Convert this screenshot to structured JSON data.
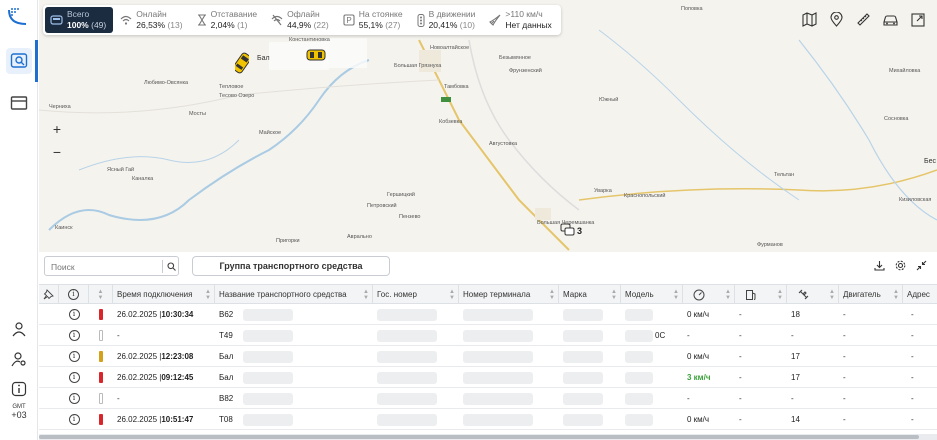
{
  "stats": [
    {
      "label": "Всего",
      "value": "100%",
      "count": "(49)",
      "icon": "car-group-icon",
      "active": true
    },
    {
      "label": "Онлайн",
      "value": "26,53%",
      "count": "(13)",
      "icon": "wifi-icon"
    },
    {
      "label": "Отставание",
      "value": "2,04%",
      "count": "(1)",
      "icon": "hourglass-icon"
    },
    {
      "label": "Офлайн",
      "value": "44,9%",
      "count": "(22)",
      "icon": "wifi-off-icon"
    },
    {
      "label": "На стоянке",
      "value": "55,1%",
      "count": "(27)",
      "icon": "parking-icon"
    },
    {
      "label": "В движении",
      "value": "20,41%",
      "count": "(10)",
      "icon": "traffic-light-icon"
    },
    {
      "label": ">110 км/ч",
      "value": "Нет данных",
      "count": "",
      "icon": "rocket-icon"
    }
  ],
  "map": {
    "zoom_in": "+",
    "zoom_out": "−",
    "cluster_count": "3",
    "places": [
      {
        "name": "Поповка",
        "cls": "p1"
      },
      {
        "name": "Новоалтайское",
        "cls": "p2"
      },
      {
        "name": "Константиновка",
        "cls": "p3"
      },
      {
        "name": "Большая Грязнуха",
        "cls": "p4"
      },
      {
        "name": "Фрунзенский",
        "cls": "p5"
      },
      {
        "name": "Безымянное",
        "cls": "p6"
      },
      {
        "name": "Михайловка",
        "cls": "p7"
      },
      {
        "name": "Тамбовка",
        "cls": "p8"
      },
      {
        "name": "Любимо-Овсянка",
        "cls": "p9"
      },
      {
        "name": "Тепловое",
        "cls": "p10"
      },
      {
        "name": "Тесово Озеро",
        "cls": "p11"
      },
      {
        "name": "Мосты",
        "cls": "p12"
      },
      {
        "name": "Черниха",
        "cls": "p13"
      },
      {
        "name": "Кобзевка",
        "cls": "p14"
      },
      {
        "name": "Южный",
        "cls": "p15"
      },
      {
        "name": "Майское",
        "cls": "p16"
      },
      {
        "name": "Августовка",
        "cls": "p17"
      },
      {
        "name": "Ясный Гай",
        "cls": "p18"
      },
      {
        "name": "Каналка",
        "cls": "p19"
      },
      {
        "name": "Уварка",
        "cls": "p20"
      },
      {
        "name": "Краснопольский",
        "cls": "p21"
      },
      {
        "name": "Тельтан",
        "cls": "p22"
      },
      {
        "name": "Гершицкий",
        "cls": "p23"
      },
      {
        "name": "Петровский",
        "cls": "p24"
      },
      {
        "name": "Пензево",
        "cls": "p25"
      },
      {
        "name": "Кизиловская",
        "cls": "p26"
      },
      {
        "name": "Аврально",
        "cls": "p27"
      },
      {
        "name": "Пригорки",
        "cls": "p28"
      },
      {
        "name": "Большая Черемшанка",
        "cls": "p29"
      },
      {
        "name": "Фурманов",
        "cls": "p30"
      },
      {
        "name": "Каинск",
        "cls": "p31"
      },
      {
        "name": "Сосновка",
        "cls": "p32"
      },
      {
        "name": "Бал",
        "cls": "p33"
      },
      {
        "name": "Бес",
        "cls": "p34"
      }
    ]
  },
  "toolbar": {
    "search_placeholder": "Поиск",
    "group_button": "Группа транспортного средства"
  },
  "table": {
    "headers": {
      "connect_time": "Время подключения",
      "vehicle_name": "Название транспортного средства",
      "plate": "Гос. номер",
      "terminal": "Номер терминала",
      "brand": "Марка",
      "model": "Модель",
      "engine": "Двигатель",
      "address": "Адрес"
    },
    "rows": [
      {
        "status": "#d9262b",
        "date": "26.02.2025 | ",
        "time": "10:30:34",
        "name": "В62",
        "model_suffix": "",
        "speed": "0 км/ч",
        "speed_green": false,
        "fuel": "-",
        "sat": "18",
        "engine": "-",
        "addr": "-"
      },
      {
        "status": "#ffffff",
        "date": "-",
        "time": "",
        "name": "Т49",
        "model_suffix": "0С",
        "speed": "-",
        "speed_green": false,
        "fuel": "-",
        "sat": "-",
        "engine": "-",
        "addr": "-"
      },
      {
        "status": "#d4a21a",
        "date": "26.02.2025 | ",
        "time": "12:23:08",
        "name": "Бал",
        "model_suffix": "",
        "speed": "0 км/ч",
        "speed_green": false,
        "fuel": "-",
        "sat": "17",
        "engine": "-",
        "addr": "-"
      },
      {
        "status": "#d9262b",
        "date": "26.02.2025 | ",
        "time": "09:12:45",
        "name": "Бал",
        "model_suffix": "",
        "speed": "3 км/ч",
        "speed_green": true,
        "fuel": "-",
        "sat": "17",
        "engine": "-",
        "addr": "-"
      },
      {
        "status": "#ffffff",
        "date": "-",
        "time": "",
        "name": "В82",
        "model_suffix": "",
        "speed": "-",
        "speed_green": false,
        "fuel": "-",
        "sat": "-",
        "engine": "-",
        "addr": "-"
      },
      {
        "status": "#d9262b",
        "date": "26.02.2025 | ",
        "time": "10:51:47",
        "name": "Т08",
        "model_suffix": "",
        "speed": "0 км/ч",
        "speed_green": false,
        "fuel": "-",
        "sat": "14",
        "engine": "-",
        "addr": "-"
      }
    ]
  },
  "rail": {
    "gmt_label": "GMT",
    "gmt_value": "+03"
  },
  "colors": {
    "accent": "#1e6fd0",
    "active_stat_bg": "#1b2b40",
    "status_red": "#d9262b",
    "status_yellow": "#d4a21a",
    "speed_green": "#3aa23a"
  }
}
